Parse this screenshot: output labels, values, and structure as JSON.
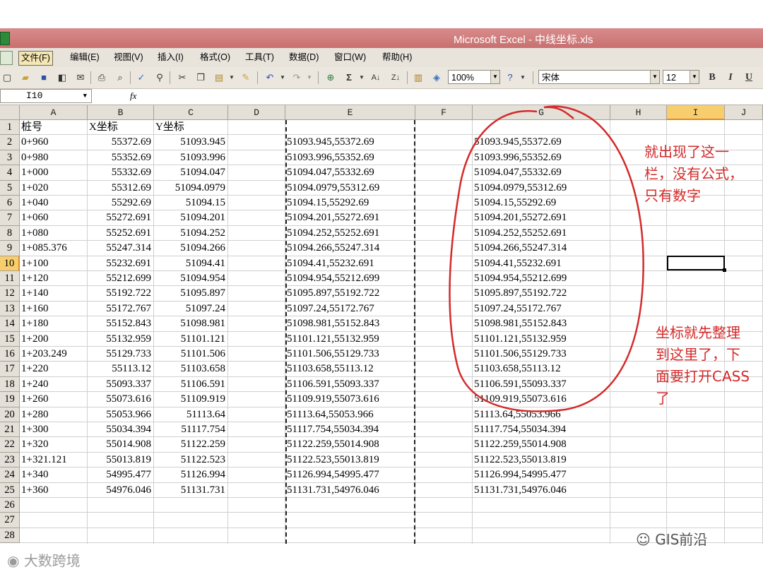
{
  "window": {
    "title": "Microsoft Excel - 中线坐标.xls"
  },
  "menu": [
    {
      "label": "文件(F)",
      "active": true
    },
    {
      "label": "编辑(E)"
    },
    {
      "label": "视图(V)"
    },
    {
      "label": "插入(I)"
    },
    {
      "label": "格式(O)"
    },
    {
      "label": "工具(T)"
    },
    {
      "label": "数据(D)"
    },
    {
      "label": "窗口(W)"
    },
    {
      "label": "帮助(H)"
    }
  ],
  "toolbar": {
    "zoom": "100%",
    "font": "宋体",
    "font_size": "12",
    "bold": "B",
    "italic": "I",
    "underline": "U",
    "sigma": "Σ"
  },
  "formula_bar": {
    "name_box": "I10",
    "fx": "fx"
  },
  "columns": [
    "A",
    "B",
    "C",
    "D",
    "E",
    "F",
    "G",
    "H",
    "I",
    "J"
  ],
  "active_column": "I",
  "active_row": 10,
  "rows": [
    {
      "n": "1",
      "A": "桩号",
      "B": "X坐标",
      "C": "Y坐标",
      "E": "",
      "G": ""
    },
    {
      "n": "2",
      "A": "0+960",
      "B": "55372.69",
      "C": "51093.945",
      "E": "51093.945,55372.69",
      "G": "51093.945,55372.69"
    },
    {
      "n": "3",
      "A": "0+980",
      "B": "55352.69",
      "C": "51093.996",
      "E": "51093.996,55352.69",
      "G": "51093.996,55352.69"
    },
    {
      "n": "4",
      "A": "1+000",
      "B": "55332.69",
      "C": "51094.047",
      "E": "51094.047,55332.69",
      "G": "51094.047,55332.69"
    },
    {
      "n": "5",
      "A": "1+020",
      "B": "55312.69",
      "C": "51094.0979",
      "E": "51094.0979,55312.69",
      "G": "51094.0979,55312.69"
    },
    {
      "n": "6",
      "A": "1+040",
      "B": "55292.69",
      "C": "51094.15",
      "E": "51094.15,55292.69",
      "G": "51094.15,55292.69"
    },
    {
      "n": "7",
      "A": "1+060",
      "B": "55272.691",
      "C": "51094.201",
      "E": "51094.201,55272.691",
      "G": "51094.201,55272.691"
    },
    {
      "n": "8",
      "A": "1+080",
      "B": "55252.691",
      "C": "51094.252",
      "E": "51094.252,55252.691",
      "G": "51094.252,55252.691"
    },
    {
      "n": "9",
      "A": "1+085.376",
      "B": "55247.314",
      "C": "51094.266",
      "E": "51094.266,55247.314",
      "G": "51094.266,55247.314"
    },
    {
      "n": "10",
      "A": "1+100",
      "B": "55232.691",
      "C": "51094.41",
      "E": "51094.41,55232.691",
      "G": "51094.41,55232.691"
    },
    {
      "n": "11",
      "A": "1+120",
      "B": "55212.699",
      "C": "51094.954",
      "E": "51094.954,55212.699",
      "G": "51094.954,55212.699"
    },
    {
      "n": "12",
      "A": "1+140",
      "B": "55192.722",
      "C": "51095.897",
      "E": "51095.897,55192.722",
      "G": "51095.897,55192.722"
    },
    {
      "n": "13",
      "A": "1+160",
      "B": "55172.767",
      "C": "51097.24",
      "E": "51097.24,55172.767",
      "G": "51097.24,55172.767"
    },
    {
      "n": "14",
      "A": "1+180",
      "B": "55152.843",
      "C": "51098.981",
      "E": "51098.981,55152.843",
      "G": "51098.981,55152.843"
    },
    {
      "n": "15",
      "A": "1+200",
      "B": "55132.959",
      "C": "51101.121",
      "E": "51101.121,55132.959",
      "G": "51101.121,55132.959"
    },
    {
      "n": "16",
      "A": "1+203.249",
      "B": "55129.733",
      "C": "51101.506",
      "E": "51101.506,55129.733",
      "G": "51101.506,55129.733"
    },
    {
      "n": "17",
      "A": "1+220",
      "B": "55113.12",
      "C": "51103.658",
      "E": "51103.658,55113.12",
      "G": "51103.658,55113.12"
    },
    {
      "n": "18",
      "A": "1+240",
      "B": "55093.337",
      "C": "51106.591",
      "E": "51106.591,55093.337",
      "G": "51106.591,55093.337"
    },
    {
      "n": "19",
      "A": "1+260",
      "B": "55073.616",
      "C": "51109.919",
      "E": "51109.919,55073.616",
      "G": "51109.919,55073.616"
    },
    {
      "n": "20",
      "A": "1+280",
      "B": "55053.966",
      "C": "51113.64",
      "E": "51113.64,55053.966",
      "G": "51113.64,55053.966"
    },
    {
      "n": "21",
      "A": "1+300",
      "B": "55034.394",
      "C": "51117.754",
      "E": "51117.754,55034.394",
      "G": "51117.754,55034.394"
    },
    {
      "n": "22",
      "A": "1+320",
      "B": "55014.908",
      "C": "51122.259",
      "E": "51122.259,55014.908",
      "G": "51122.259,55014.908"
    },
    {
      "n": "23",
      "A": "1+321.121",
      "B": "55013.819",
      "C": "51122.523",
      "E": "51122.523,55013.819",
      "G": "51122.523,55013.819"
    },
    {
      "n": "24",
      "A": "1+340",
      "B": "54995.477",
      "C": "51126.994",
      "E": "51126.994,54995.477",
      "G": "51126.994,54995.477"
    },
    {
      "n": "25",
      "A": "1+360",
      "B": "54976.046",
      "C": "51131.731",
      "E": "51131.731,54976.046",
      "G": "51131.731,54976.046"
    },
    {
      "n": "26"
    },
    {
      "n": "27"
    },
    {
      "n": "28"
    }
  ],
  "annotations": {
    "note1": [
      "就出现了这一",
      "栏，没有公式，",
      "只有数字"
    ],
    "note2": [
      "坐标就先整理",
      "到这里了，下",
      "面要打开CASS",
      "了"
    ],
    "color": "#d42a2a"
  },
  "watermarks": {
    "left": "大数跨境",
    "right": "GIS前沿"
  },
  "colors": {
    "titlebar": "#cf7d7d",
    "active_header": "#f8cd6d"
  }
}
